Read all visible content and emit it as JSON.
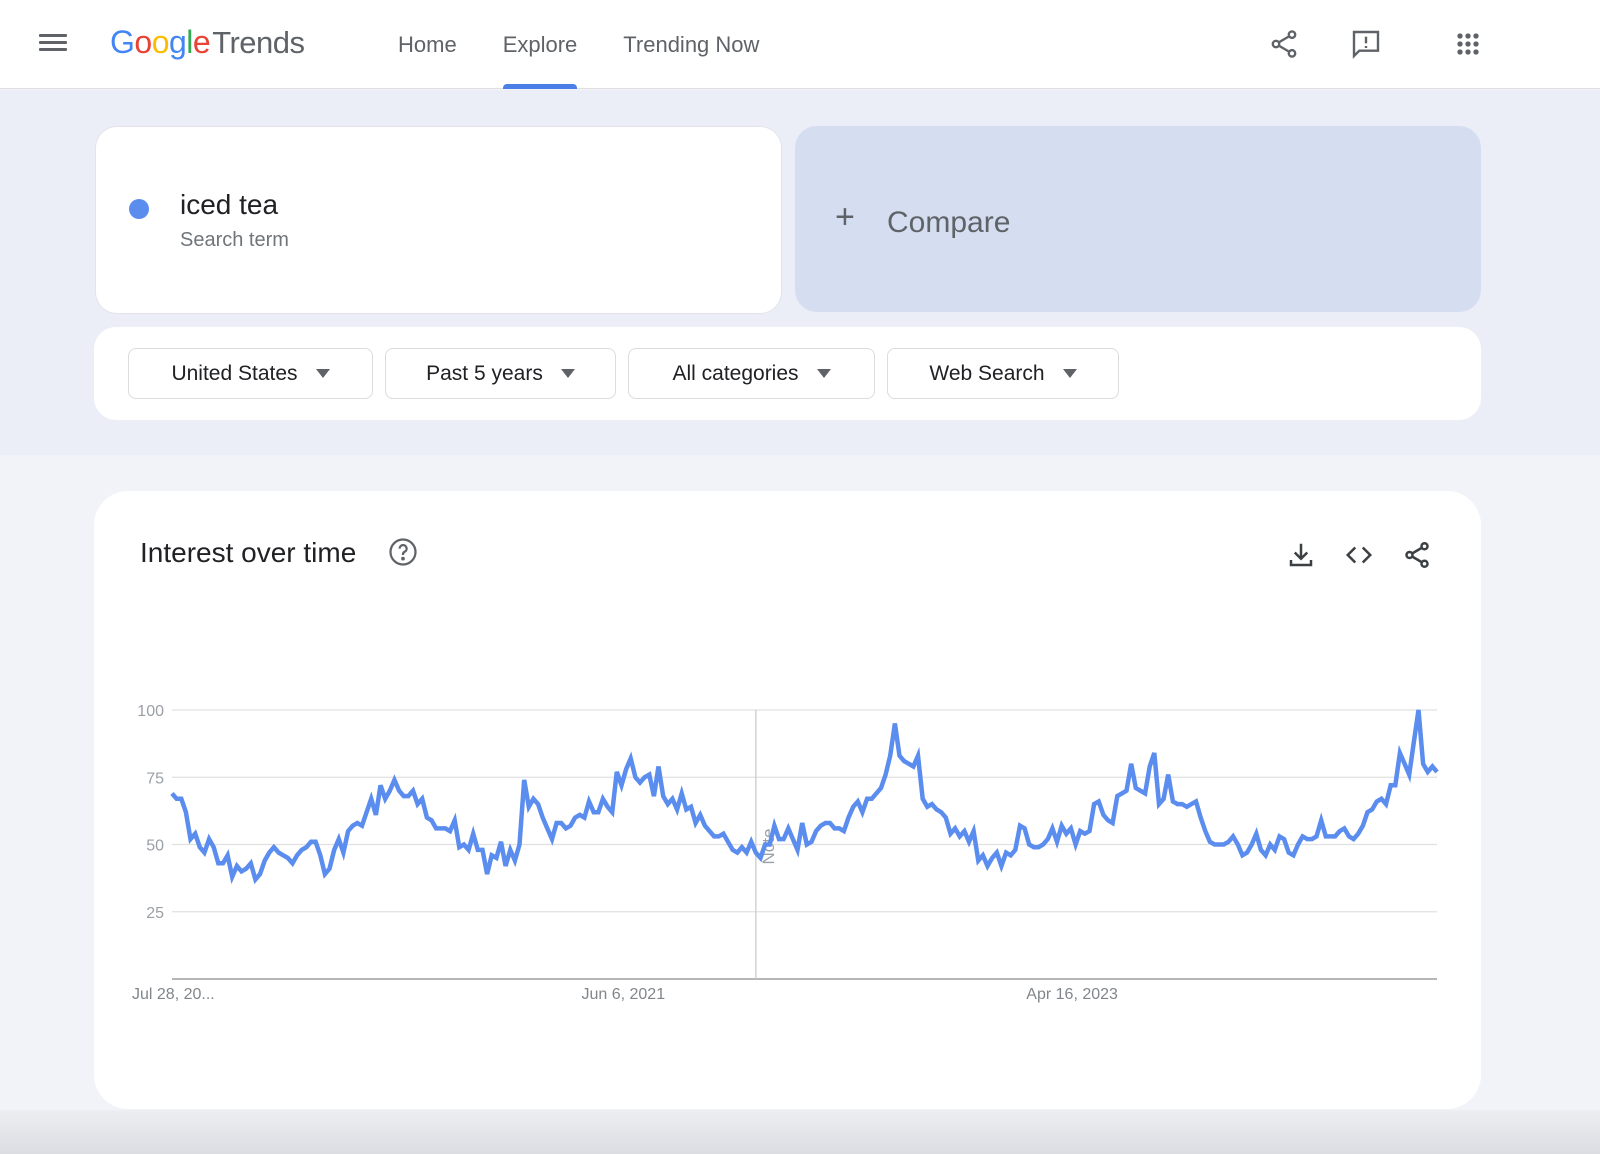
{
  "header": {
    "logo_google": [
      "G",
      "o",
      "o",
      "g",
      "l",
      "e"
    ],
    "logo_colors": [
      "#4285f4",
      "#ea4335",
      "#fbbc05",
      "#4285f4",
      "#34a853",
      "#ea4335"
    ],
    "logo_product": "Trends",
    "nav": [
      {
        "label": "Home",
        "active": false
      },
      {
        "label": "Explore",
        "active": true
      },
      {
        "label": "Trending Now",
        "active": false
      }
    ],
    "icons": [
      "share-icon",
      "feedback-icon",
      "apps-icon"
    ]
  },
  "search": {
    "term": "iced tea",
    "term_type": "Search term",
    "term_color": "#5b8def",
    "compare_label": "Compare"
  },
  "filters": [
    {
      "label": "United States"
    },
    {
      "label": "Past 5 years"
    },
    {
      "label": "All categories"
    },
    {
      "label": "Web Search"
    }
  ],
  "interest_card": {
    "title": "Interest over time",
    "actions": [
      "download-icon",
      "embed-icon",
      "share-icon"
    ]
  },
  "chart_data": {
    "type": "line",
    "title": "Interest over time",
    "xlabel": "",
    "ylabel": "",
    "ylim": [
      0,
      100
    ],
    "yticks": [
      25,
      50,
      75,
      100
    ],
    "xtick_labels": [
      {
        "label": "Jul 28, 20...",
        "index": 0
      },
      {
        "label": "Jun 6, 2021",
        "index": 97
      },
      {
        "label": "Apr 16, 2023",
        "index": 193
      }
    ],
    "annotation": {
      "label": "Note",
      "index": 126
    },
    "grid": true,
    "legend": "none",
    "series": [
      {
        "name": "iced tea",
        "color": "#5b8def",
        "values": [
          69,
          67,
          67,
          62,
          52,
          54,
          49,
          47,
          52,
          49,
          43,
          43,
          46,
          38,
          42,
          40,
          41,
          43,
          37,
          39,
          44,
          47,
          49,
          47,
          46,
          45,
          43,
          46,
          48,
          49,
          51,
          51,
          46,
          39,
          41,
          48,
          52,
          47,
          55,
          57,
          58,
          57,
          62,
          67,
          61,
          72,
          67,
          70,
          74,
          70,
          68,
          68,
          70,
          65,
          67,
          60,
          59,
          56,
          56,
          56,
          55,
          59,
          49,
          50,
          48,
          54,
          48,
          48,
          39,
          46,
          45,
          51,
          42,
          48,
          44,
          50,
          74,
          64,
          67,
          65,
          60,
          56,
          52,
          58,
          58,
          56,
          57,
          60,
          61,
          60,
          66,
          62,
          62,
          67,
          64,
          62,
          77,
          72,
          78,
          82,
          75,
          73,
          75,
          76,
          68,
          79,
          68,
          65,
          67,
          63,
          69,
          63,
          64,
          58,
          61,
          57,
          55,
          53,
          53,
          54,
          51,
          48,
          47,
          49,
          47,
          51,
          47,
          45,
          50,
          50,
          57,
          52,
          52,
          56,
          52,
          48,
          58,
          50,
          51,
          55,
          57,
          58,
          58,
          56,
          56,
          55,
          60,
          64,
          66,
          62,
          67,
          67,
          69,
          71,
          76,
          83,
          95,
          83,
          81,
          80,
          79,
          83,
          67,
          64,
          65,
          63,
          62,
          60,
          54,
          56,
          53,
          55,
          51,
          55,
          44,
          46,
          42,
          45,
          47,
          42,
          47,
          46,
          48,
          57,
          56,
          50,
          49,
          49,
          50,
          52,
          56,
          51,
          57,
          54,
          56,
          50,
          55,
          54,
          55,
          65,
          66,
          61,
          59,
          58,
          68,
          69,
          70,
          80,
          71,
          70,
          69,
          79,
          84,
          65,
          67,
          76,
          66,
          65,
          65,
          64,
          65,
          66,
          60,
          55,
          51,
          50,
          50,
          50,
          51,
          53,
          50,
          46,
          47,
          50,
          54,
          48,
          46,
          50,
          48,
          53,
          52,
          47,
          46,
          50,
          53,
          52,
          52,
          53,
          59,
          53,
          53,
          53,
          55,
          56,
          53,
          52,
          54,
          57,
          62,
          63,
          66,
          67,
          65,
          72,
          72,
          84,
          80,
          76,
          88,
          100,
          80,
          77,
          79,
          77
        ]
      }
    ]
  }
}
